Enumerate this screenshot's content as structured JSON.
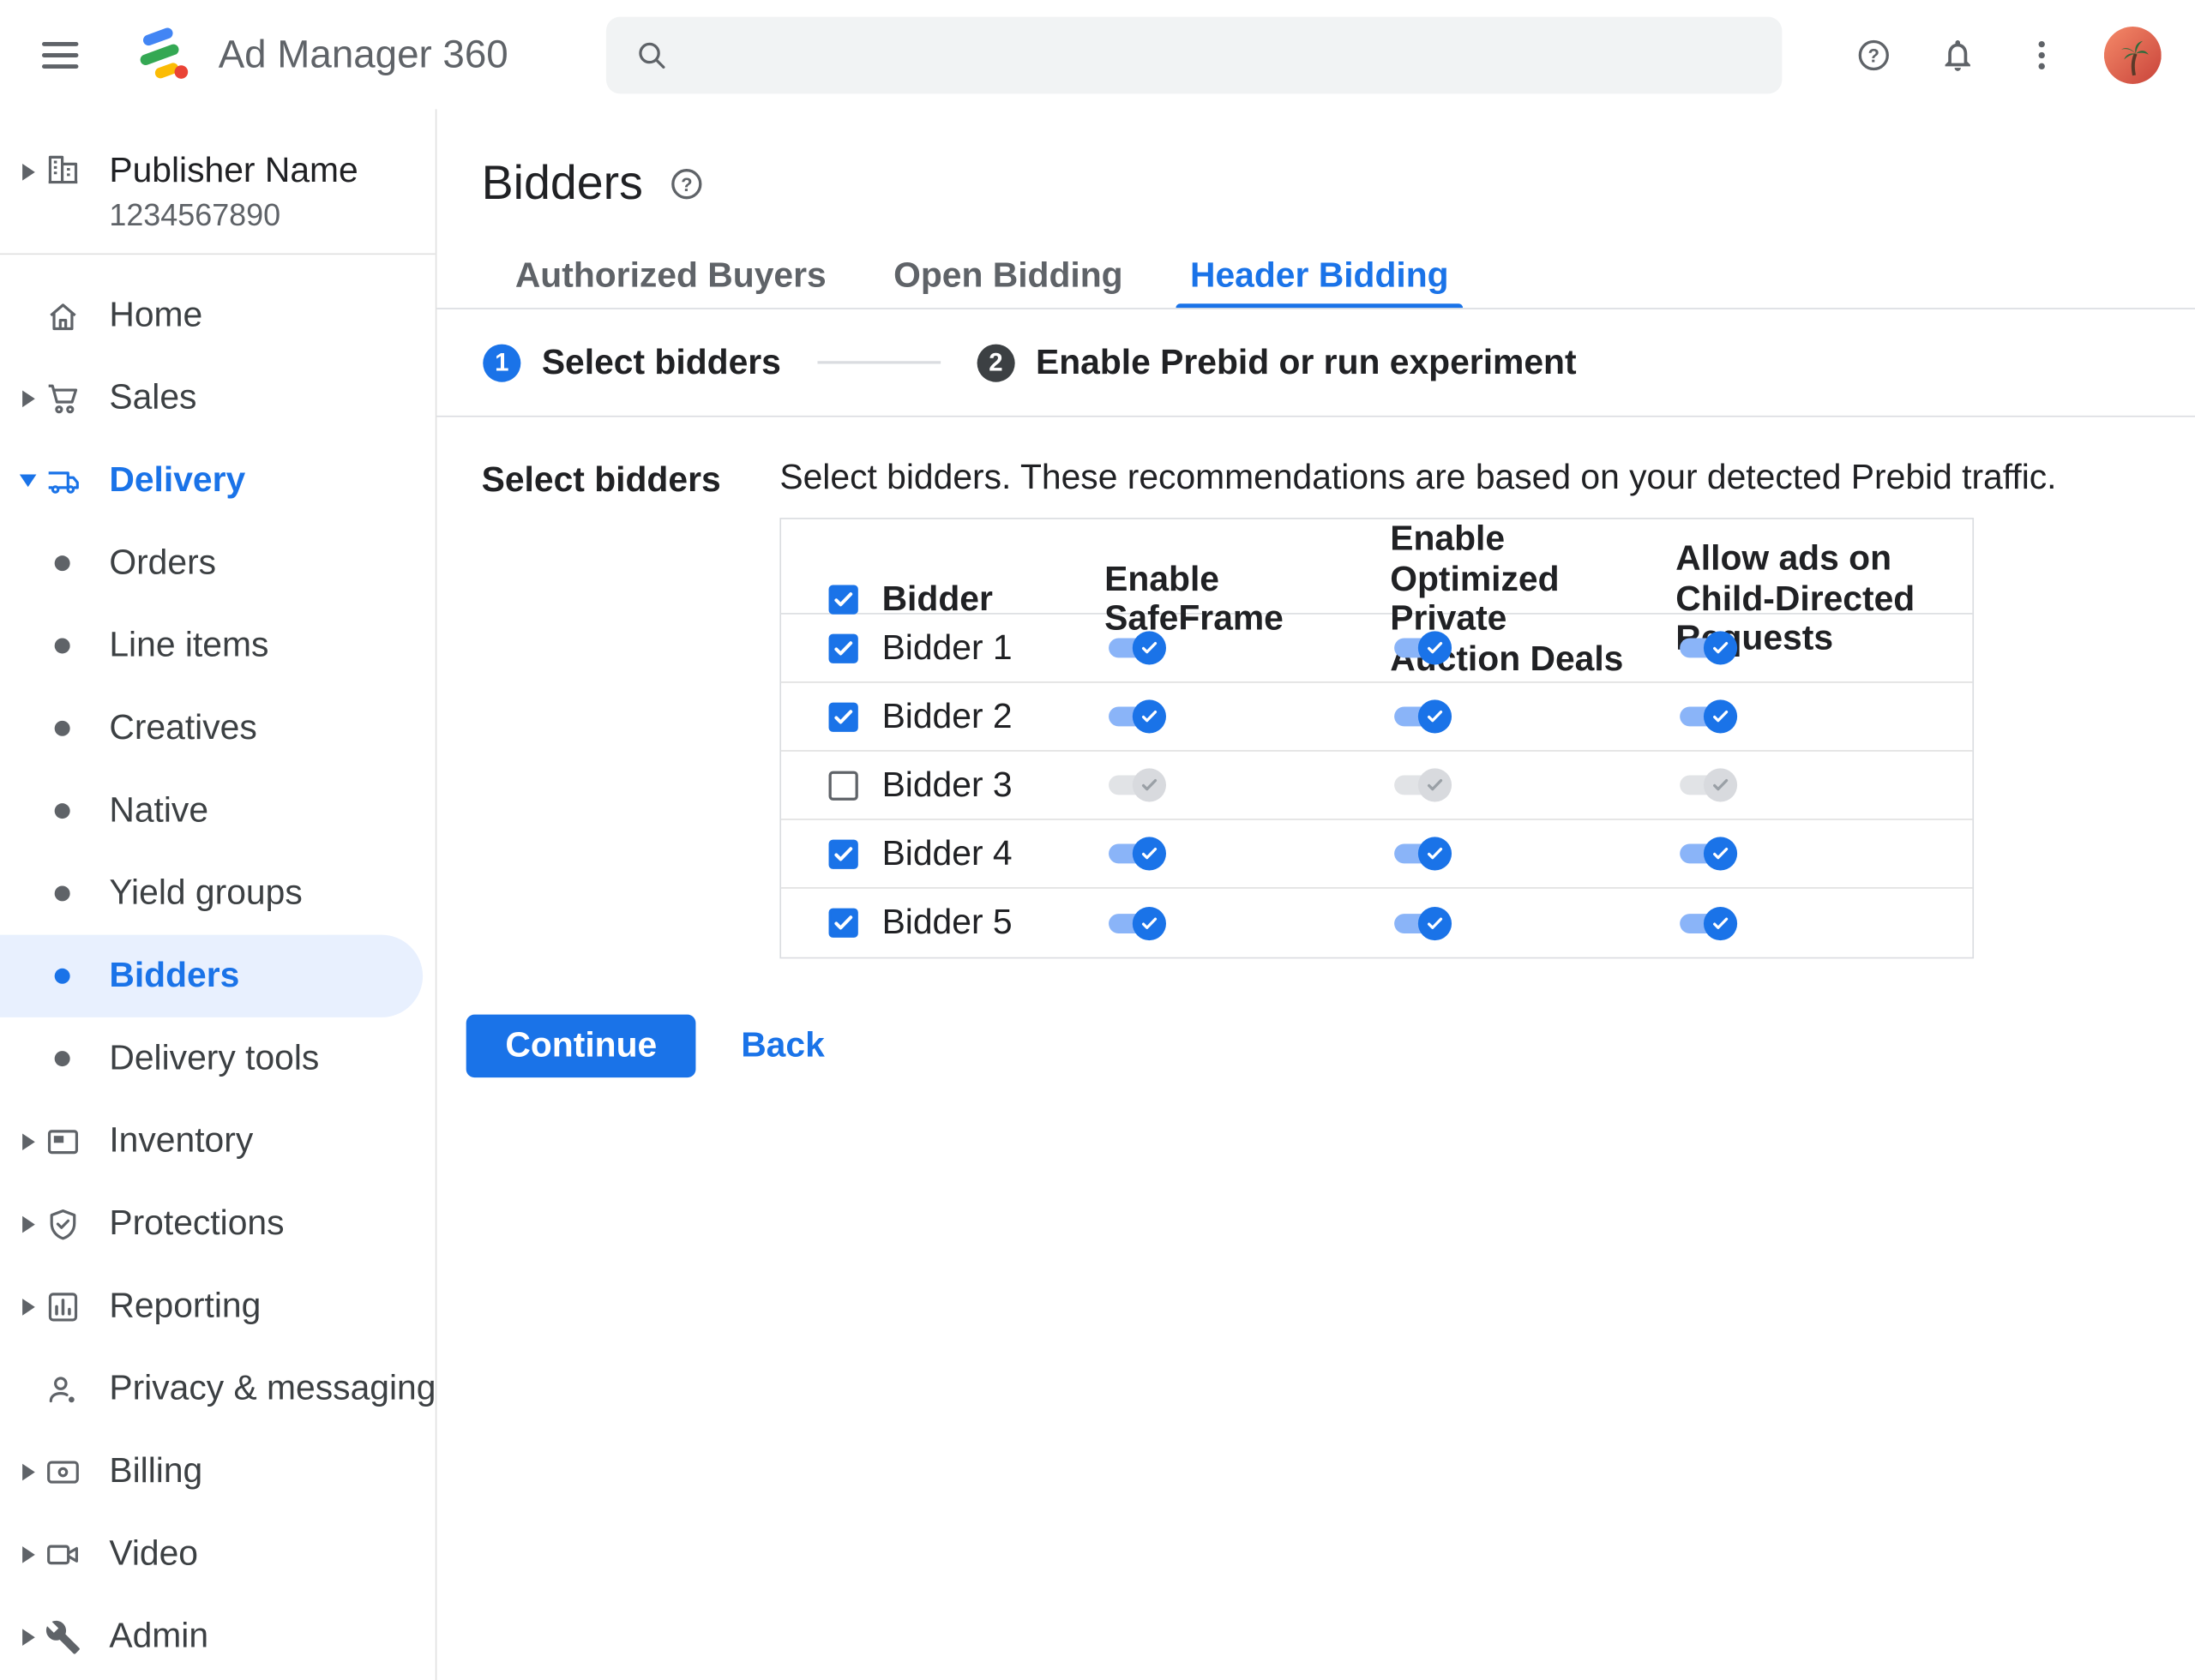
{
  "colors": {
    "accent": "#1a73e8",
    "active_item_bg": "#e8f0fe",
    "toggle_on_thumb": "#1a73e8",
    "toggle_on_track": "#8ab4f8",
    "toggle_off_thumb": "#d8dade",
    "text_primary": "#202124",
    "text_secondary": "#5f6368"
  },
  "topbar": {
    "app_name": "Ad Manager 360",
    "search_value": ""
  },
  "sidebar": {
    "publisher_name": "Publisher Name",
    "publisher_id": "1234567890",
    "items": [
      {
        "label": "Home",
        "icon": "home-icon"
      },
      {
        "label": "Sales",
        "icon": "cart-icon",
        "expandable": true
      },
      {
        "label": "Delivery",
        "icon": "truck-icon",
        "expanded": true
      },
      {
        "label": "Orders",
        "icon": "bullet-icon"
      },
      {
        "label": "Line items",
        "icon": "bullet-icon"
      },
      {
        "label": "Creatives",
        "icon": "bullet-icon"
      },
      {
        "label": "Native",
        "icon": "bullet-icon"
      },
      {
        "label": "Yield groups",
        "icon": "bullet-icon"
      },
      {
        "label": "Bidders",
        "icon": "bullet-icon",
        "active": true
      },
      {
        "label": "Delivery tools",
        "icon": "bullet-icon"
      },
      {
        "label": "Inventory",
        "icon": "inventory-icon",
        "expandable": true
      },
      {
        "label": "Protections",
        "icon": "shield-icon",
        "expandable": true
      },
      {
        "label": "Reporting",
        "icon": "bar-chart-icon",
        "expandable": true
      },
      {
        "label": "Privacy & messaging",
        "icon": "person-icon"
      },
      {
        "label": "Billing",
        "icon": "credit-card-icon",
        "expandable": true
      },
      {
        "label": "Video",
        "icon": "videocam-icon",
        "expandable": true
      },
      {
        "label": "Admin",
        "icon": "wrench-icon",
        "expandable": true
      }
    ]
  },
  "page": {
    "title": "Bidders",
    "tabs": [
      {
        "label": "Authorized Buyers",
        "active": false
      },
      {
        "label": "Open Bidding",
        "active": false
      },
      {
        "label": "Header Bidding",
        "active": true
      }
    ],
    "stepper": [
      {
        "number": "1",
        "label": "Select bidders"
      },
      {
        "number": "2",
        "label": "Enable Prebid or run experiment"
      }
    ],
    "section_label": "Select bidders",
    "description": "Select bidders. These recommendations are based on your detected Prebid traffic.",
    "table": {
      "select_all": true,
      "headers": [
        "Bidder",
        "Enable SafeFrame",
        "Enable Optimized Private Auction Deals",
        "Allow ads on Child-Directed Requests"
      ],
      "rows": [
        {
          "name": "Bidder 1",
          "selected": true,
          "enable_safeframe": true,
          "optimized_deals": true,
          "child_directed": true
        },
        {
          "name": "Bidder 2",
          "selected": true,
          "enable_safeframe": true,
          "optimized_deals": true,
          "child_directed": true
        },
        {
          "name": "Bidder 3",
          "selected": false,
          "enable_safeframe": false,
          "optimized_deals": false,
          "child_directed": false
        },
        {
          "name": "Bidder 4",
          "selected": true,
          "enable_safeframe": true,
          "optimized_deals": true,
          "child_directed": true
        },
        {
          "name": "Bidder 5",
          "selected": true,
          "enable_safeframe": true,
          "optimized_deals": true,
          "child_directed": true
        }
      ]
    },
    "continue_label": "Continue",
    "back_label": "Back"
  }
}
